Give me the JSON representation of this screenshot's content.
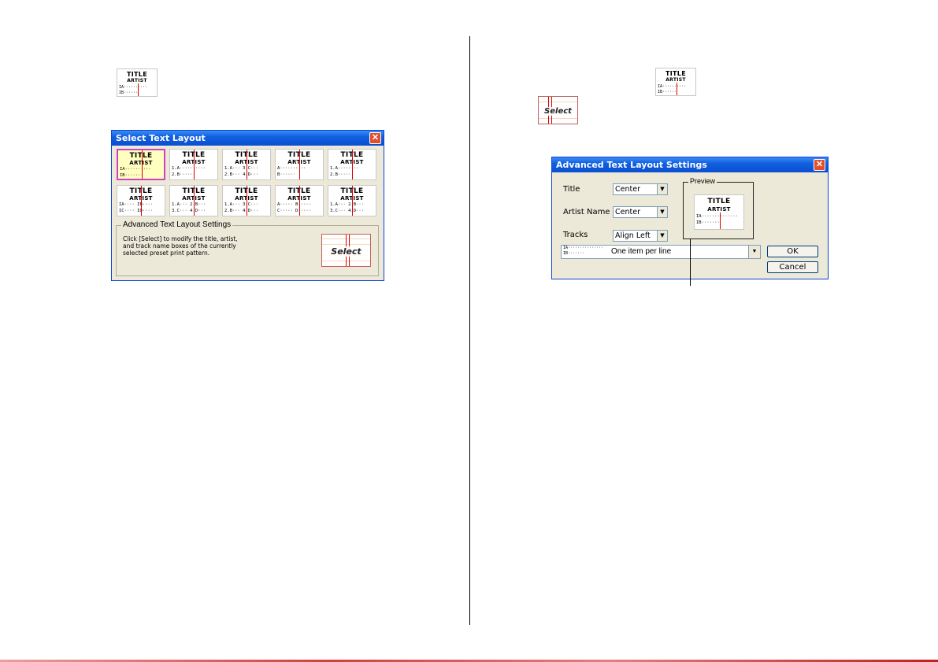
{
  "left_icon": {
    "title": "TITLE",
    "artist": "ARTIST",
    "line1": "IA··········",
    "line2": "IB······"
  },
  "right_icon": {
    "title": "TITLE",
    "artist": "ARTIST",
    "line1": "IA··········",
    "line2": "IB······"
  },
  "select_icon": {
    "label": "Select"
  },
  "select_dialog": {
    "title": "Select Text Layout",
    "close": "✕",
    "layouts": [
      {
        "title": "TITLE",
        "artist": "ARTIST",
        "l1": "IA··········",
        "l2": "IB·······",
        "selected": true
      },
      {
        "title": "TITLE",
        "artist": "ARTIST",
        "l1": "1.A··········",
        "l2": "2.B······"
      },
      {
        "title": "TITLE",
        "artist": "ARTIST",
        "l1": "1.A··· 3.C···",
        "l2": "2.B··· 4.D···"
      },
      {
        "title": "TITLE",
        "artist": "ARTIST",
        "l1": "A··········",
        "l2": "B······"
      },
      {
        "title": "TITLE",
        "artist": "ARTIST",
        "l1": "1.A········",
        "l2": "2.B·····"
      },
      {
        "title": "TITLE",
        "artist": "ARTIST",
        "l1": "IA···· IB····",
        "l2": "IC···· ID····"
      },
      {
        "title": "TITLE",
        "artist": "ARTIST",
        "l1": "1.A··· 2.B···",
        "l2": "3.C··· 4.D···"
      },
      {
        "title": "TITLE",
        "artist": "ARTIST",
        "l1": "1.A··· 3.C···",
        "l2": "2.B··· 4.D···"
      },
      {
        "title": "TITLE",
        "artist": "ARTIST",
        "l1": "A····· B·····",
        "l2": "C····· D·····"
      },
      {
        "title": "TITLE",
        "artist": "ARTIST",
        "l1": "1.A··· 2.B···",
        "l2": "3.C··· 4.D···"
      }
    ],
    "group_label": "Advanced Text Layout Settings",
    "group_text": "Click [Select] to modify the title, artist, and track name boxes of the currently selected preset print pattern.",
    "select_button": "Select"
  },
  "advanced_dialog": {
    "title": "Advanced Text Layout Settings",
    "close": "✕",
    "title_label": "Title",
    "title_value": "Center",
    "artist_label": "Artist Name",
    "artist_value": "Center",
    "tracks_label": "Tracks",
    "tracks_value": "Align Left",
    "preview_label": "Preview",
    "preview": {
      "title": "TITLE",
      "artist": "ARTIST",
      "l1": "IA··············",
      "l2": "IB·······"
    },
    "track_mode_sample1": "IA···············",
    "track_mode_sample2": "IB·······",
    "track_mode_value": "One item per line",
    "ok": "OK",
    "cancel": "Cancel"
  }
}
